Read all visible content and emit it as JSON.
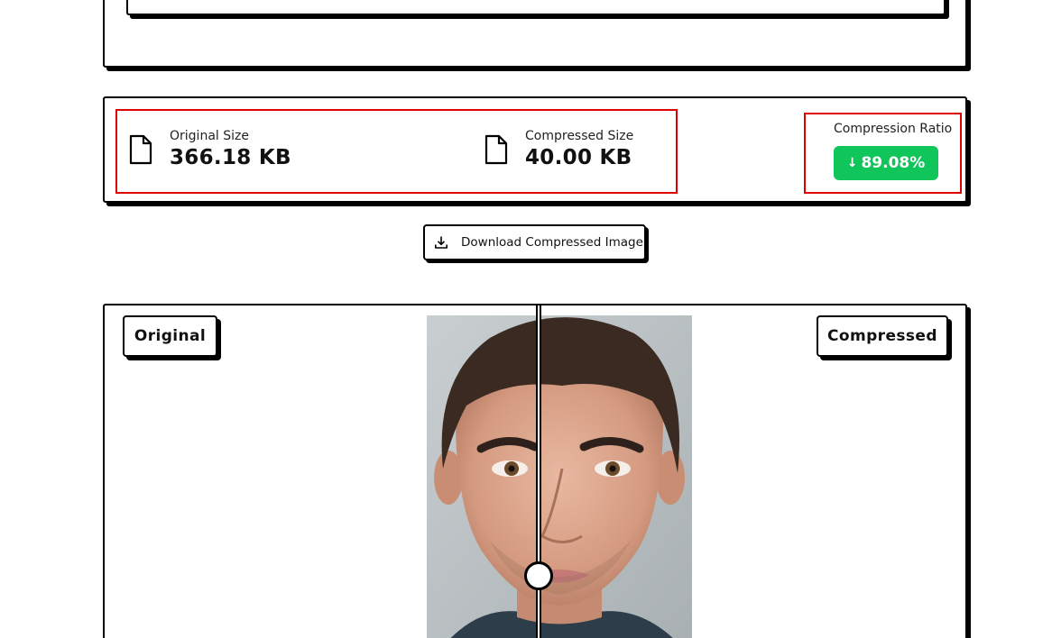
{
  "stats": {
    "original_label": "Original Size",
    "original_value": "366.18 KB",
    "compressed_label": "Compressed Size",
    "compressed_value": "40.00 KB",
    "ratio_label": "Compression Ratio",
    "ratio_value": "89.08%",
    "ratio_arrow": "↓",
    "ratio_color": "#10c65b",
    "highlight_color": "#e00000"
  },
  "download": {
    "label": "Download Compressed Image",
    "icon": "download-icon"
  },
  "comparison": {
    "original_tag": "Original",
    "compressed_tag": "Compressed",
    "slider_position": 0.42
  }
}
